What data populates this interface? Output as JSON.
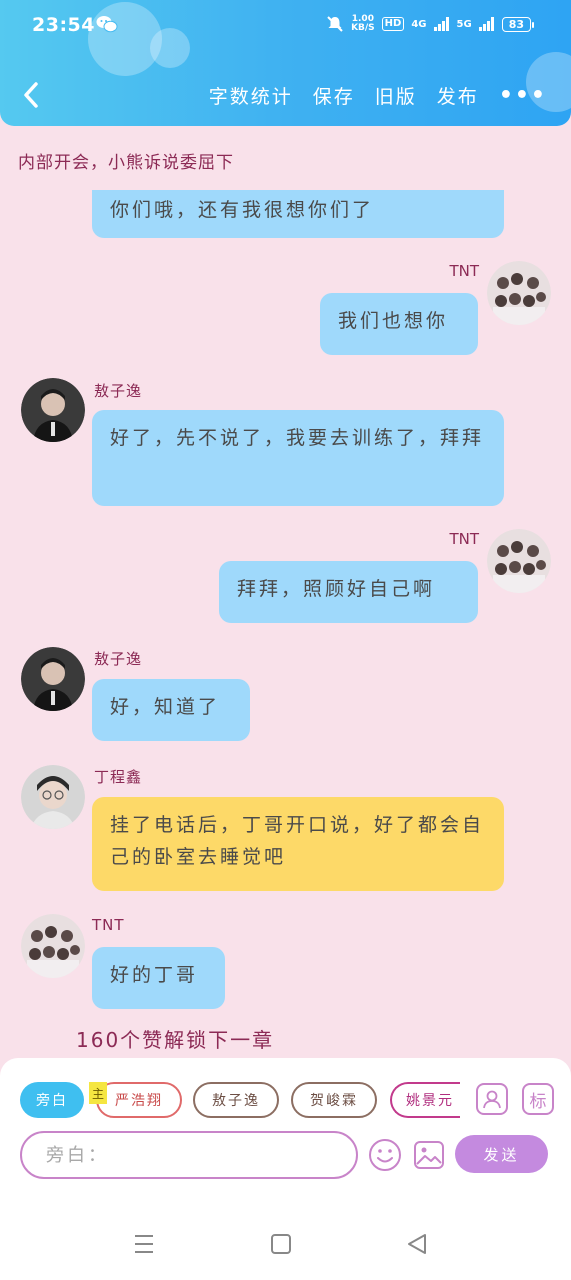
{
  "status_bar": {
    "time": "23:54",
    "speed_value": "1.00",
    "speed_unit": "KB/S",
    "hd_label": "HD",
    "network_4g": "4G",
    "network_5g": "5G",
    "battery": "83",
    "icons": [
      "wechat-icon",
      "mute-icon",
      "signal-icon",
      "battery-icon"
    ]
  },
  "header": {
    "back_icon": "chevron-left-icon",
    "toolbar": {
      "word_count": "字数统计",
      "save": "保存",
      "old_version": "旧版",
      "publish": "发布",
      "more": "•••"
    },
    "accent": "#3fb1f1"
  },
  "chapter_title": "内部开会，小熊诉说委屈下",
  "messages": [
    {
      "side": "left",
      "speaker": "",
      "text": "你们哦，还有我很想你们了",
      "color": "#9fd9fb"
    },
    {
      "side": "right",
      "speaker": "TNT",
      "text": "我们也想你",
      "color": "#9fd9fb"
    },
    {
      "side": "left",
      "speaker": "敖子逸",
      "text": "好了，先不说了，我要去训练了，拜拜",
      "color": "#9fd9fb"
    },
    {
      "side": "right",
      "speaker": "TNT",
      "text": "拜拜，照顾好自己啊",
      "color": "#9fd9fb"
    },
    {
      "side": "left",
      "speaker": "敖子逸",
      "text": "好，知道了",
      "color": "#9fd9fb"
    },
    {
      "side": "left",
      "speaker": "丁程鑫",
      "text": "挂了电话后，丁哥开口说，好了都会自己的卧室去睡觉吧",
      "color": "#fdd968"
    },
    {
      "side": "left",
      "speaker": "TNT",
      "text": "好的丁哥",
      "color": "#9fd9fb"
    }
  ],
  "unlock_notice": "160个赞解锁下一章",
  "composer": {
    "roles": [
      "旁白",
      "严浩翔",
      "敖子逸",
      "贺峻霖",
      "姚景元"
    ],
    "lead_tag": "主",
    "person_icon": "person-icon",
    "tag_label": "标",
    "input_placeholder": "旁白：",
    "emoji_icon": "smiley-icon",
    "image_icon": "image-icon",
    "send": "发送"
  },
  "nav_bar": {
    "icons": [
      "menu-icon",
      "home-square-icon",
      "back-triangle-icon"
    ]
  }
}
